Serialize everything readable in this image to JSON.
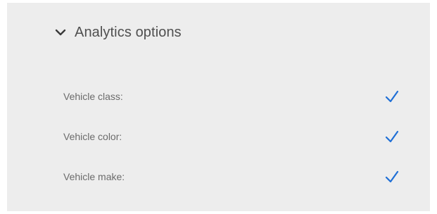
{
  "analytics": {
    "section_title": "Analytics options",
    "expanded": true,
    "icon": "chevron-down-icon",
    "accent_color": "#1f6fd6",
    "options": [
      {
        "label": "Vehicle class:",
        "checked": true
      },
      {
        "label": "Vehicle color:",
        "checked": true
      },
      {
        "label": "Vehicle make:",
        "checked": true
      }
    ]
  }
}
